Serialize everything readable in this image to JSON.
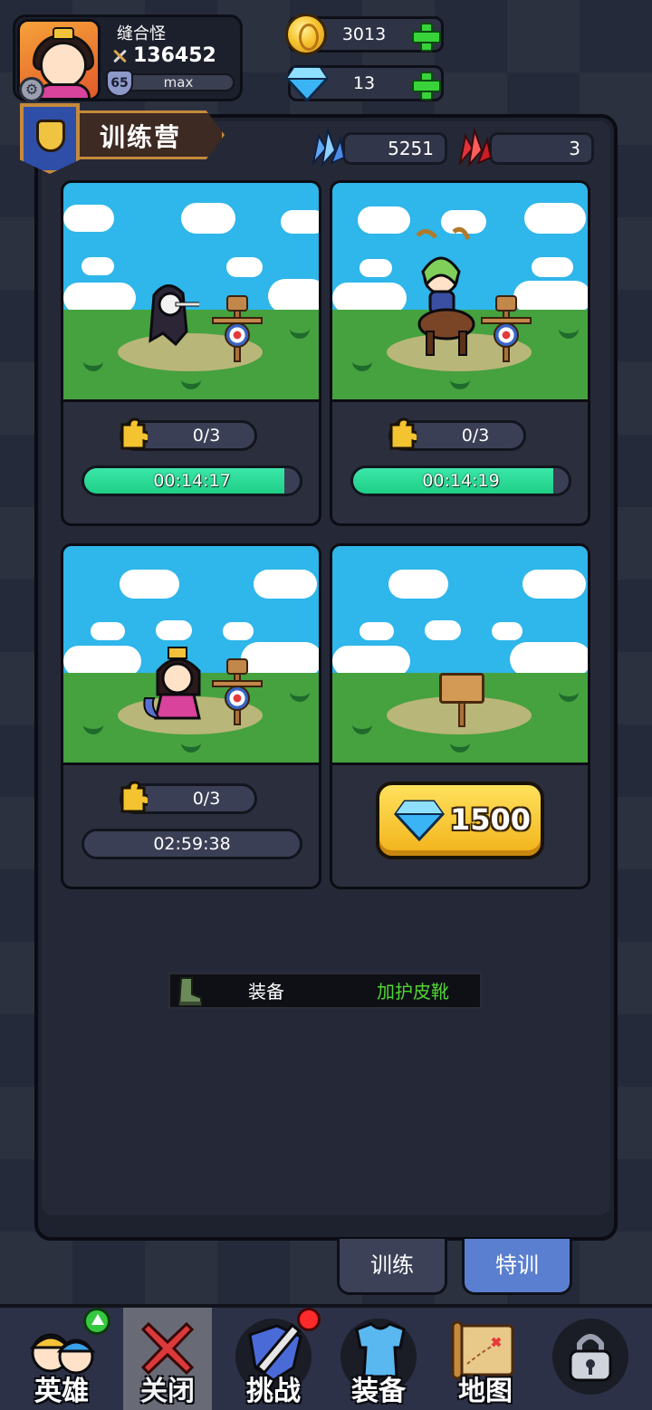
{
  "player": {
    "name": "缝合怪",
    "power": "136452",
    "level": "65",
    "level_status": "max"
  },
  "currencies": {
    "gold": "3013",
    "diamond": "13"
  },
  "panel": {
    "title": "训练营",
    "blue_crystal": "5251",
    "red_crystal": "3"
  },
  "slots": [
    {
      "pieces": "0/3",
      "timer": "00:14:17",
      "progress": 0.93,
      "active": true
    },
    {
      "pieces": "0/3",
      "timer": "00:14:19",
      "progress": 0.93,
      "active": true
    },
    {
      "pieces": "0/3",
      "timer": "02:59:38",
      "progress": 0.0,
      "active": false
    },
    {
      "unlock_cost": "1500"
    }
  ],
  "toast": {
    "type": "装备",
    "item": "加护皮靴",
    "item_color": "#4fd632"
  },
  "tabs": [
    {
      "label": "训练",
      "active": false
    },
    {
      "label": "特训",
      "active": true
    }
  ],
  "bottom_nav": [
    {
      "label": "英雄",
      "icon": "heroes-icon",
      "badge": "upgrade-arrow"
    },
    {
      "label": "关闭",
      "icon": "close-icon",
      "selected": true
    },
    {
      "label": "挑战",
      "icon": "sword-shield-icon",
      "badge": "red-dot"
    },
    {
      "label": "装备",
      "icon": "armor-icon"
    },
    {
      "label": "地图",
      "icon": "map-icon"
    },
    {
      "label": "",
      "icon": "lock-icon"
    }
  ],
  "colors": {
    "timer_fill": "#1fcf86",
    "active_tab": "#5a7fd0",
    "panel_bg": "#252937"
  }
}
